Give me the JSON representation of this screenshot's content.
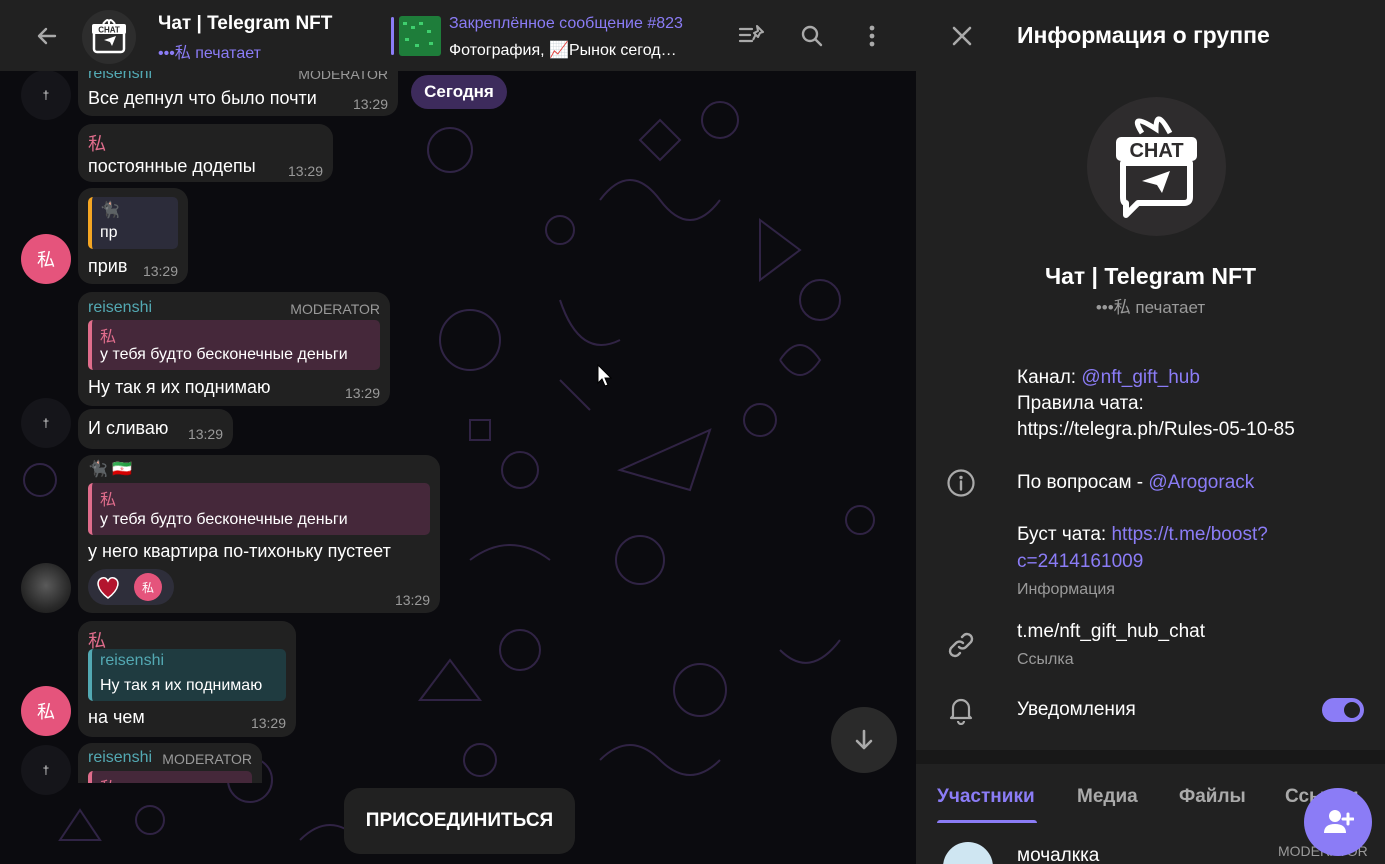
{
  "header": {
    "title": "Чат | Telegram NFT",
    "status": "•••私 печатает",
    "pinned_title": "Закреплённое сообщение #823",
    "pinned_text": "Фотография, 📈Рынок сегод…"
  },
  "date_pill": "Сегодня",
  "messages": [
    {
      "sender": "reisenshi",
      "badge": "MODERATOR",
      "text": "Все депнул что было почти",
      "time": "13:29"
    },
    {
      "sender": "私",
      "text": "постоянные додепы",
      "time": "13:29"
    },
    {
      "quote_sender": "🐈‍⬛",
      "quote_text": "пр",
      "text": "прив",
      "time": "13:29"
    },
    {
      "sender": "reisenshi",
      "badge": "MODERATOR",
      "quote_sender": "私",
      "quote_text": "у тебя будто бесконечные деньги",
      "text": "Ну так я их поднимаю",
      "time": "13:29"
    },
    {
      "text": "И сливаю",
      "time": "13:29"
    },
    {
      "sender": "🐈‍⬛ 🇮🇷",
      "quote_sender": "私",
      "quote_text": "у тебя будто бесконечные деньги",
      "text": "у него квартира по-тихоньку пустеет",
      "time": "13:29",
      "reaction_avatar": "私"
    },
    {
      "sender": "私",
      "quote_sender": "reisenshi",
      "quote_text": "Ну так я их поднимаю",
      "text": "на чем",
      "time": "13:29"
    },
    {
      "sender": "reisenshi",
      "badge": "MODERATOR",
      "quote_sender": "私"
    }
  ],
  "avatar_labels": {
    "pink": "私",
    "dark": "†"
  },
  "join_button": "ПРИСОЕДИНИТЬСЯ",
  "panel": {
    "title": "Информация о группе",
    "group_name": "Чат | Telegram NFT",
    "group_status": "•••私 печатает",
    "channel_label": "Канал: ",
    "channel_link": "@nft_gift_hub",
    "rules_label": "Правила чата:",
    "rules_link": "https://telegra.ph/Rules-05-10-85",
    "questions_label": "По вопросам - ",
    "questions_link": "@Arogorack",
    "boost_label": "Буст чата: ",
    "boost_link_1": "https://t.me/boost?",
    "boost_link_2": "c=2414161009",
    "info_caption": "Информация",
    "link_value": "t.me/nft_gift_hub_chat",
    "link_caption": "Ссылка",
    "notifications_label": "Уведомления",
    "notifications_on": true,
    "tabs": [
      "Участники",
      "Медиа",
      "Файлы",
      "Ссылки"
    ],
    "member_name": "мочалкка",
    "member_badge": "MODERATOR"
  },
  "logo_text": "CHAT",
  "icons": [
    "back-arrow-icon",
    "pinned-list-icon",
    "search-icon",
    "more-vertical-icon",
    "close-icon",
    "info-icon",
    "link-icon",
    "bell-icon",
    "arrow-down-icon",
    "add-user-icon"
  ],
  "colors": {
    "accent": "#8b7cf6",
    "teal": "#53a9b3",
    "pink": "#e06d8c",
    "bubble": "#212121"
  }
}
